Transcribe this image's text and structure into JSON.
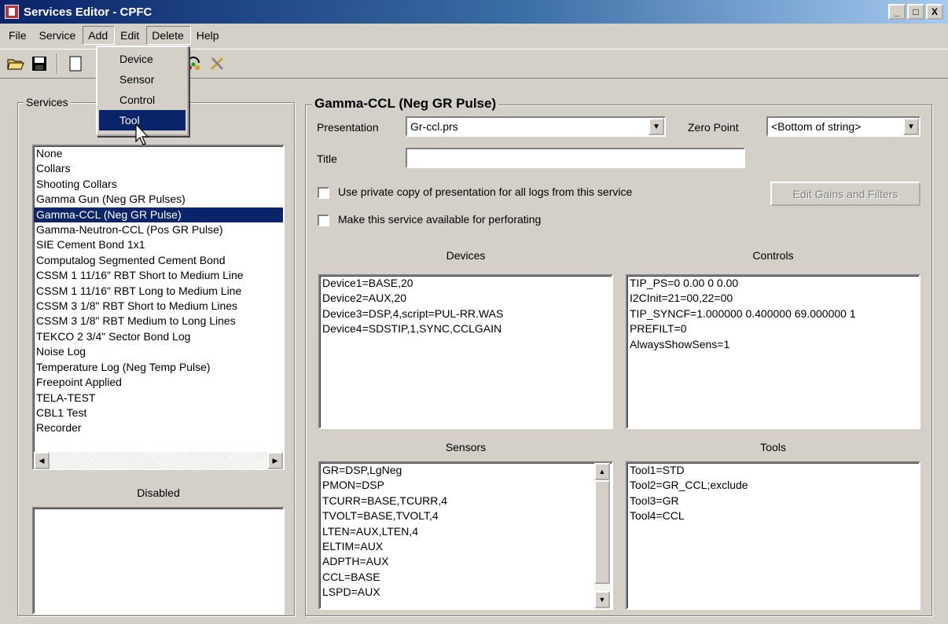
{
  "window": {
    "title": "Services Editor - CPFC",
    "min": "_",
    "max": "□",
    "close": "X"
  },
  "menubar": [
    "File",
    "Service",
    "Add",
    "Edit",
    "Delete",
    "Help"
  ],
  "add_menu": {
    "items": [
      "Device",
      "Sensor",
      "Control",
      "Tool"
    ],
    "selected": "Tool"
  },
  "services": {
    "group_title": "Services",
    "items": [
      "None",
      "Collars",
      "Shooting Collars",
      "Gamma Gun (Neg GR Pulses)",
      "Gamma-CCL (Neg GR Pulse)",
      "Gamma-Neutron-CCL (Pos GR Pulse)",
      "SIE Cement Bond 1x1",
      "Computalog Segmented Cement Bond",
      "CSSM 1 11/16\" RBT Short to Medium Line",
      "CSSM 1 11/16\" RBT Long to Medium Line",
      "CSSM 3 1/8\" RBT Short to Medium Lines",
      "CSSM 3 1/8\" RBT Medium to Long Lines",
      "TEKCO 2 3/4\" Sector Bond Log",
      "Noise Log",
      "Temperature Log (Neg Temp Pulse)",
      "Freepoint Applied",
      "TELA-TEST",
      "CBL1 Test",
      "Recorder"
    ],
    "selected_index": 4,
    "disabled_label": "Disabled"
  },
  "detail": {
    "group_title": "Gamma-CCL (Neg GR Pulse)",
    "presentation_label": "Presentation",
    "presentation_value": "Gr-ccl.prs",
    "zero_point_label": "Zero Point",
    "zero_point_value": "<Bottom of string>",
    "title_label": "Title",
    "title_value": "",
    "private_copy_label": "Use private copy of presentation for all logs from this service",
    "perforating_label": "Make this service available for perforating",
    "edit_gains_button": "Edit Gains and Filters",
    "devices_title": "Devices",
    "devices": [
      "Device1=BASE,20",
      "Device2=AUX,20",
      "Device3=DSP,4,script=PUL-RR.WAS",
      "Device4=SDSTIP,1,SYNC,CCLGAIN"
    ],
    "controls_title": "Controls",
    "controls": [
      "TIP_PS=0 0.00 0 0.00",
      "I2CInit=21=00,22=00",
      "TIP_SYNCF=1.000000 0.400000 69.000000 1",
      "PREFILT=0",
      "AlwaysShowSens=1"
    ],
    "sensors_title": "Sensors",
    "sensors": [
      "GR=DSP,LgNeg",
      "PMON=DSP",
      "TCURR=BASE,TCURR,4",
      "TVOLT=BASE,TVOLT,4",
      "LTEN=AUX,LTEN,4",
      "ELTIM=AUX",
      "ADPTH=AUX",
      "CCL=BASE",
      "LSPD=AUX"
    ],
    "tools_title": "Tools",
    "tools": [
      "Tool1=STD",
      "Tool2=GR_CCL;exclude",
      "Tool3=GR",
      "Tool4=CCL"
    ]
  }
}
